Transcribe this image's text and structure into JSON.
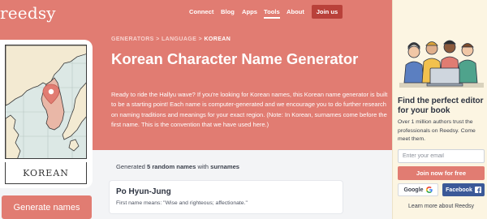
{
  "header": {
    "logo": "reedsy",
    "nav": [
      "Connect",
      "Blog",
      "Apps",
      "Tools",
      "About"
    ],
    "join_label": "Join us"
  },
  "hero": {
    "breadcrumb": {
      "items": [
        "GENERATORS",
        "LANGUAGE"
      ],
      "separator": ">",
      "current": "KOREAN"
    },
    "title": "Korean Character Name Generator",
    "description": "Ready to ride the Hallyu wave? If you're looking for Korean names, this Korean name generator is built to be a starting point! Each name is computer-generated and we encourage you to do further research on naming traditions and meanings for your exact region. (Note: In Korean, surnames come before the first name. This is the convention that we have used here.)",
    "card_label": "KOREAN",
    "generate_label": "Generate names"
  },
  "results": {
    "prefix": "Generated",
    "count": "5 random names",
    "middle": "with",
    "kind": "surnames",
    "items": [
      {
        "name": "Po Hyun-Jung",
        "meaning": "First name means: \"Wise and righteous; affectionate.\""
      }
    ]
  },
  "sidebar": {
    "title": "Find the perfect editor for your book",
    "text": "Over 1 million authors trust the professionals on Reedsy. Come meet them.",
    "email_placeholder": "Enter your email",
    "join_free_label": "Join now for free",
    "google_label": "Google",
    "facebook_label": "Facebook",
    "learn_more": "Learn more about Reedsy"
  },
  "colors": {
    "brand": "#e17c72",
    "brand_dark": "#b9413a",
    "sidebar_bg": "#fcf5e2",
    "facebook": "#3b5998"
  },
  "icons": [
    "location-pin-icon",
    "google-icon",
    "facebook-icon"
  ]
}
